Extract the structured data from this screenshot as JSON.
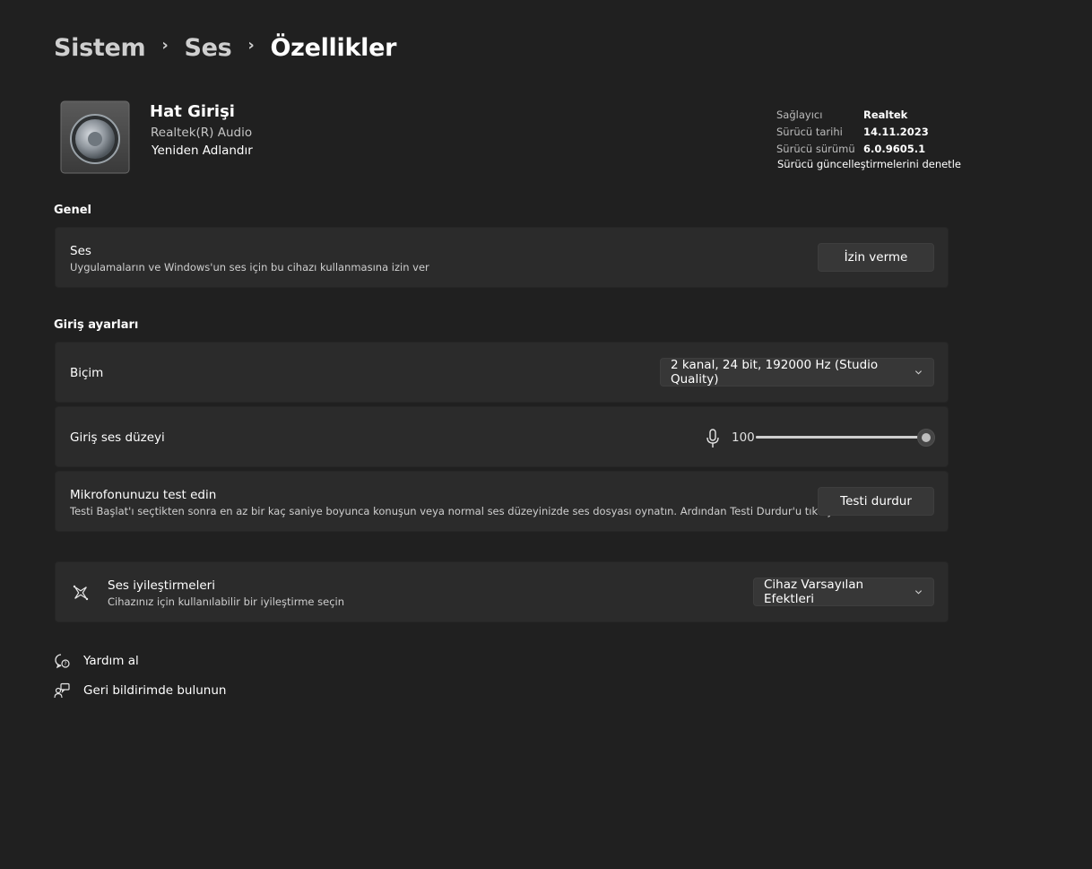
{
  "breadcrumb": {
    "items": [
      "Sistem",
      "Ses",
      "Özellikler"
    ],
    "separator": "›"
  },
  "device": {
    "name": "Hat Girişi",
    "driver_name": "Realtek(R) Audio",
    "rename_label": "Yeniden Adlandır",
    "icon": "speaker-icon"
  },
  "driver_info": {
    "provider_label": "Sağlayıcı",
    "provider_value": "Realtek",
    "date_label": "Sürücü tarihi",
    "date_value": "14.11.2023",
    "version_label": "Sürücü sürümü",
    "version_value": "6.0.9605.1",
    "update_link": "Sürücü güncelleştirmelerini denetle"
  },
  "general": {
    "title": "Genel",
    "audio": {
      "title": "Ses",
      "description": "Uygulamaların ve Windows'un ses için bu cihazı kullanmasına izin ver",
      "button": "İzin verme"
    }
  },
  "input_settings": {
    "title": "Giriş ayarları",
    "format": {
      "title": "Biçim",
      "selected": "2 kanal, 24 bit, 192000 Hz (Studio Quality)"
    },
    "volume": {
      "title": "Giriş ses düzeyi",
      "value": "100",
      "level_percent": 100,
      "icon": "microphone-icon"
    },
    "test": {
      "title": "Mikrofonunuzu test edin",
      "description": "Testi Başlat'ı seçtikten sonra en az bir kaç saniye boyunca konuşun veya normal ses düzeyinizde ses dosyası oynatın. Ardından Testi Durdur'u tıklayın",
      "button": "Testi durdur"
    }
  },
  "enhancements": {
    "title": "Ses iyileştirmeleri",
    "description": "Cihazınız için kullanılabilir bir iyileştirme seçin",
    "selected": "Cihaz Varsayılan Efektleri",
    "icon": "sparkle-icon"
  },
  "links": {
    "help": "Yardım al",
    "feedback": "Geri bildirimde bulunun"
  },
  "colors": {
    "background": "#202020",
    "card": "#2b2b2b",
    "button": "#373737"
  }
}
